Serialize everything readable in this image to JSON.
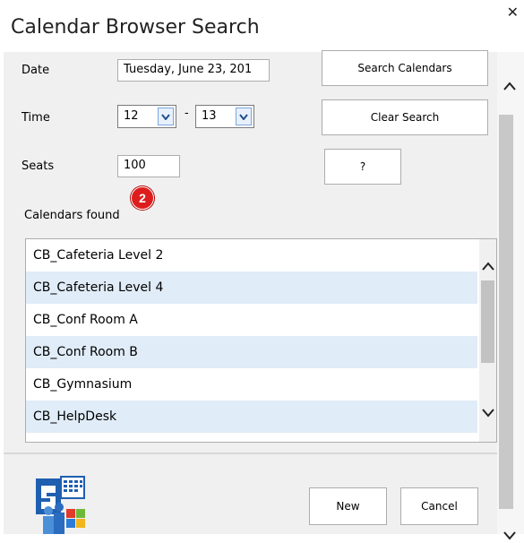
{
  "window": {
    "title": "Calendar Browser Search",
    "close_glyph": "✕"
  },
  "form": {
    "date_label": "Date",
    "date_value": "Tuesday, June 23, 201",
    "time_label": "Time",
    "time_from": "12",
    "time_separator": "-",
    "time_to": "13",
    "seats_label": "Seats",
    "seats_value": "100"
  },
  "buttons": {
    "search": "Search Calendars",
    "clear": "Clear Search",
    "help": "?",
    "new": "New",
    "cancel": "Cancel"
  },
  "results": {
    "label": "Calendars found",
    "badge": "2",
    "items": [
      "CB_Cafeteria Level 2",
      "CB_Cafeteria Level 4",
      "CB_Conf Room A",
      "CB_Conf Room B",
      "CB_Gymnasium",
      "CB_HelpDesk"
    ]
  },
  "colors": {
    "panel": "#f0f0f0",
    "row_alt": "#e0ecf7",
    "badge": "#dd1d1d"
  }
}
